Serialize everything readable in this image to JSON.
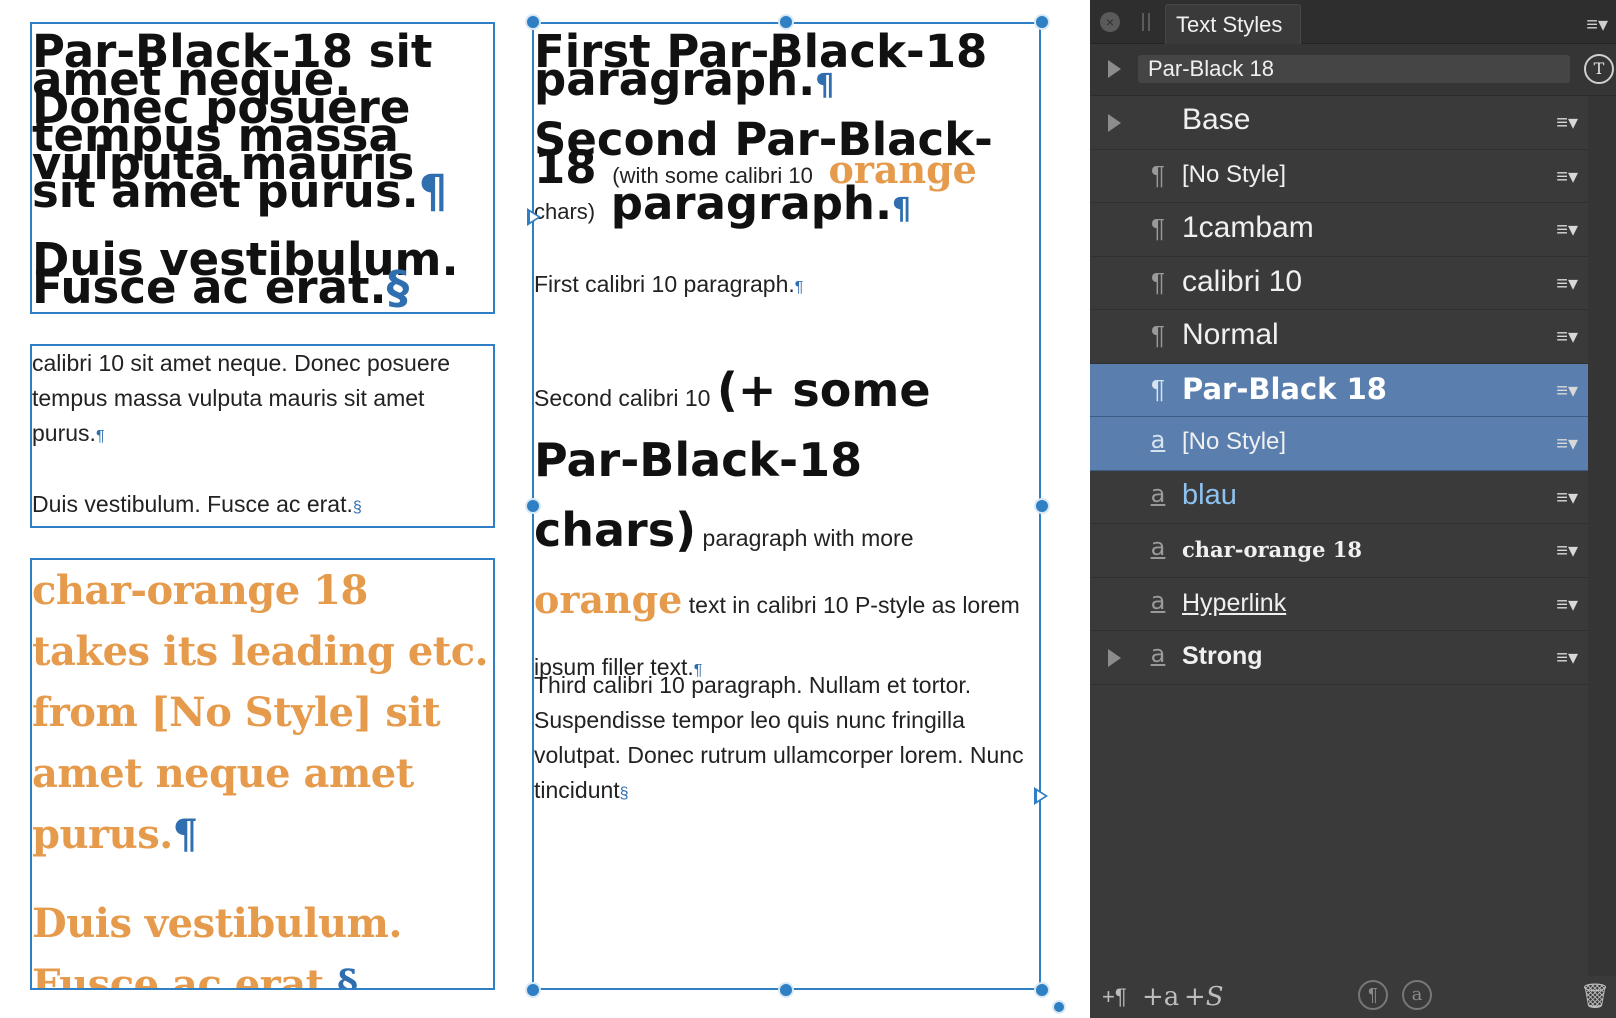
{
  "canvas": {
    "frame1": {
      "p1": "Par-Black-18 sit amet neque. Donec posuere tempus massa vulputa mauris sit amet purus.",
      "p2": "Duis vestibulum. Fusce ac erat."
    },
    "frame2": {
      "p1": "calibri 10 sit amet neque. Donec posuere tempus massa vulputa mauris sit amet purus.",
      "p2": "Duis vestibulum. Fusce ac erat."
    },
    "frame3": {
      "p1": "char-orange 18 takes its leading etc. from [No Style] sit amet neque amet purus.",
      "p2": "Duis vestibulum. Fusce ac erat."
    },
    "frame4": {
      "b1": "First Par-Black-18 paragraph.",
      "b2a": "Second Par-Black-18",
      "b2b": "(with some calibri 10",
      "b2c": "orange",
      "b2d": "chars)",
      "b2e": "paragraph.",
      "c1": "First calibri 10 paragraph.",
      "c2a": "Second calibri 10",
      "c2b": "(+ some Par-Black-18 chars)",
      "c2c": "paragraph with more",
      "c2d": "orange",
      "c2e": "text in calibri 10 P-style as lorem ipsum filler text.",
      "c3": "Third calibri 10 paragraph. Nullam et tortor. Suspendisse tempor leo quis nunc fringilla volutpat. Donec rutrum ullamcorper lorem. Nunc tincidunt"
    },
    "marks": {
      "pilcrow": "¶",
      "section": "§"
    }
  },
  "panel": {
    "tab_title": "Text Styles",
    "current_style": "Par-Black 18",
    "styles": [
      {
        "kind": "group",
        "icon": "",
        "label": "Base",
        "expandable": true,
        "selected": false
      },
      {
        "kind": "paragraph",
        "icon": "¶",
        "label": "[No Style]",
        "expandable": false,
        "selected": false
      },
      {
        "kind": "paragraph",
        "icon": "¶",
        "label": "1cambam",
        "expandable": false,
        "selected": false
      },
      {
        "kind": "paragraph",
        "icon": "¶",
        "label": "calibri 10",
        "expandable": false,
        "selected": false
      },
      {
        "kind": "paragraph",
        "icon": "¶",
        "label": "Normal",
        "expandable": false,
        "selected": false
      },
      {
        "kind": "paragraph",
        "icon": "¶",
        "label": "Par-Black 18",
        "expandable": false,
        "selected": true
      },
      {
        "kind": "character",
        "icon": "a",
        "label": "[No Style]",
        "expandable": false,
        "selected": true
      },
      {
        "kind": "character",
        "icon": "a",
        "label": "blau",
        "expandable": false,
        "selected": false
      },
      {
        "kind": "character",
        "icon": "a",
        "label": "char-orange 18",
        "expandable": false,
        "selected": false
      },
      {
        "kind": "character",
        "icon": "a",
        "label": "Hyperlink",
        "expandable": false,
        "selected": false
      },
      {
        "kind": "character",
        "icon": "a",
        "label": "Strong",
        "expandable": true,
        "selected": false
      }
    ],
    "bottom": {
      "new_paragraph": "+¶",
      "new_character": "+a",
      "new_style": "+S",
      "clear_paragraph": "¶",
      "clear_character": "a",
      "delete": "🗑"
    }
  },
  "colors": {
    "frame_border": "#2f7fc4",
    "orange_text": "#e59a4c",
    "selection": "#5a7fae",
    "panel_bg": "#3a3a3a",
    "blau": "#8ec2f0"
  }
}
